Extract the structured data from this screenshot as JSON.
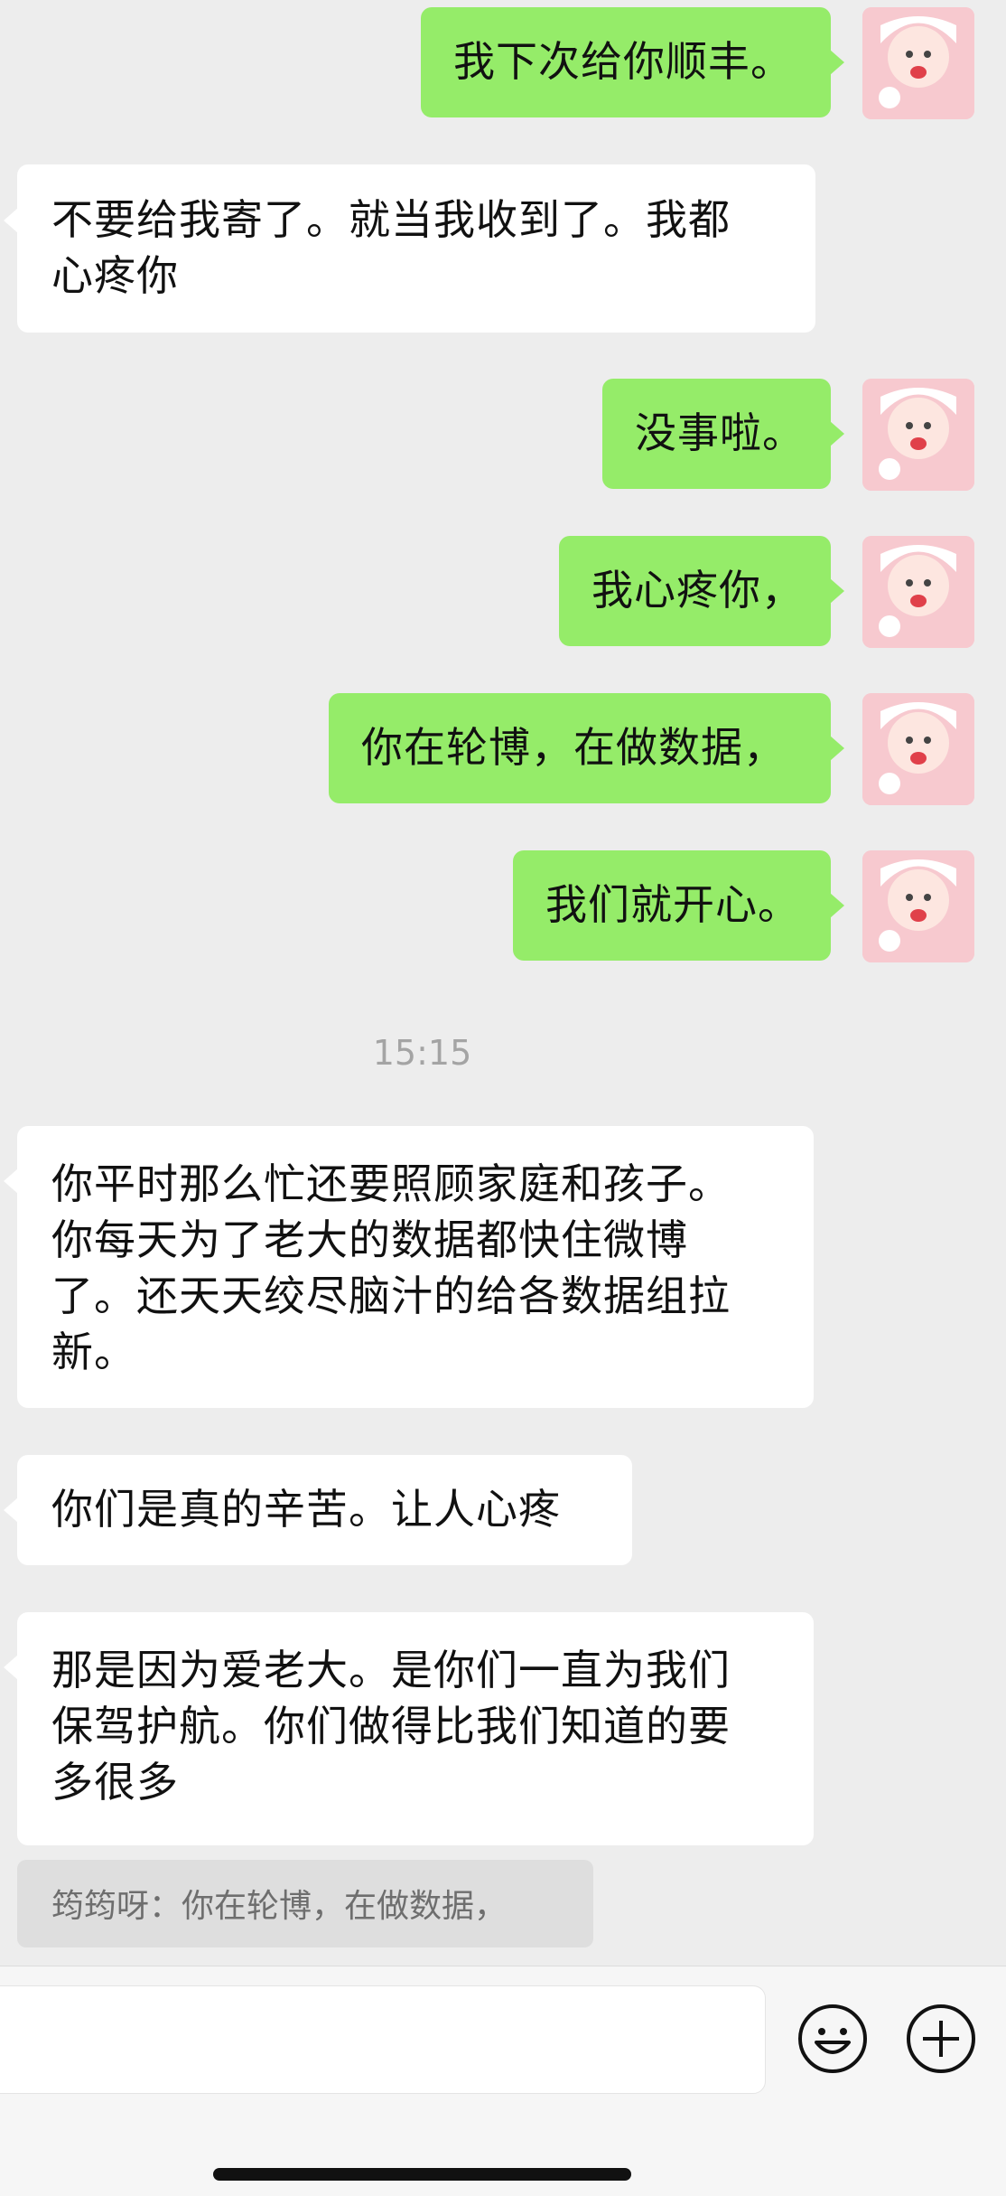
{
  "messages": [
    {
      "side": "me",
      "text": "我下次给你顺丰。"
    },
    {
      "side": "other",
      "text": "不要给我寄了。就当我收到了。我都\n心疼你"
    },
    {
      "side": "me",
      "text": "没事啦。"
    },
    {
      "side": "me",
      "text": "我心疼你，"
    },
    {
      "side": "me",
      "text": "你在轮博，在做数据，"
    },
    {
      "side": "me",
      "text": "我们就开心。"
    },
    {
      "side": "other",
      "text": "你平时那么忙还要照顾家庭和孩子。\n你每天为了老大的数据都快住微博\n了。还天天绞尽脑汁的给各数据组拉\n新。"
    },
    {
      "side": "other",
      "text": "你们是真的辛苦。让人心疼"
    },
    {
      "side": "other",
      "text": "那是因为爱老大。是你们一直为我们\n保驾护航。你们做得比我们知道的要\n多很多"
    }
  ],
  "timestamp": "15:15",
  "quote": "筠筠呀：你在轮博，在做数据，",
  "colors": {
    "background": "#ededed",
    "my_bubble": "#95ec69",
    "other_bubble": "#ffffff"
  },
  "icons": {
    "emoji": "emoji-face-icon",
    "more": "plus-circle-icon",
    "avatar": "avatar-image"
  }
}
